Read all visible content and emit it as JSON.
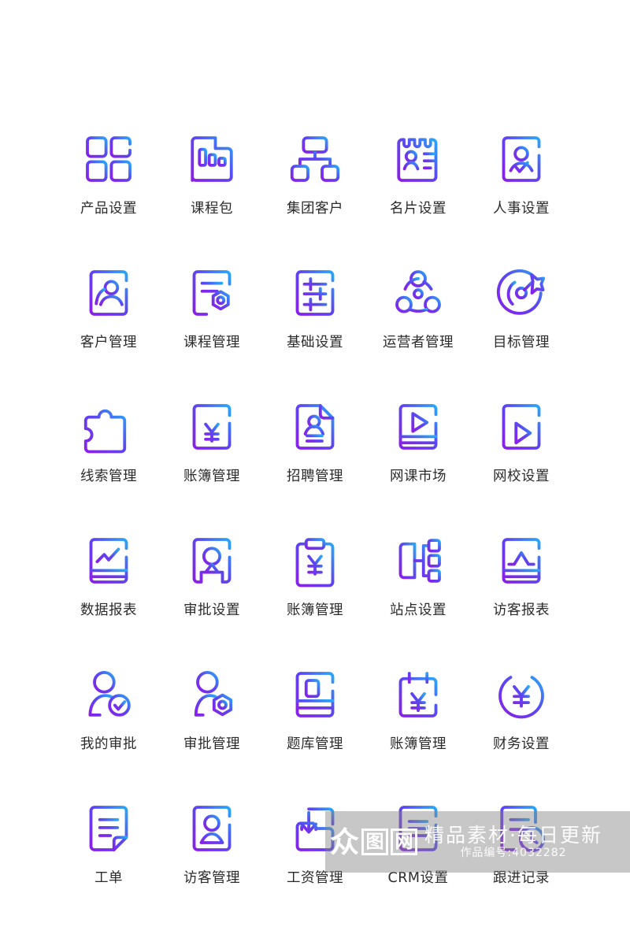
{
  "page": {
    "background": "#ffffff",
    "label_color": "#2b2b2b",
    "gradient_start": "#8A1FE8",
    "gradient_end": "#29A8F7",
    "columns": 5,
    "rows": 6,
    "total_icons": 30
  },
  "icons": [
    {
      "label": "产品设置",
      "name": "product-settings"
    },
    {
      "label": "课程包",
      "name": "course-package"
    },
    {
      "label": "集团客户",
      "name": "group-customer"
    },
    {
      "label": "名片设置",
      "name": "business-card-settings"
    },
    {
      "label": "人事设置",
      "name": "hr-settings"
    },
    {
      "label": "客户管理",
      "name": "customer-management"
    },
    {
      "label": "课程管理",
      "name": "course-management"
    },
    {
      "label": "基础设置",
      "name": "basic-settings"
    },
    {
      "label": "运营者管理",
      "name": "operator-management"
    },
    {
      "label": "目标管理",
      "name": "goal-management"
    },
    {
      "label": "线索管理",
      "name": "lead-management"
    },
    {
      "label": "账簿管理",
      "name": "ledger-management-1"
    },
    {
      "label": "招聘管理",
      "name": "recruitment-management"
    },
    {
      "label": "网课市场",
      "name": "online-course-market"
    },
    {
      "label": "网校设置",
      "name": "online-school-settings"
    },
    {
      "label": "数据报表",
      "name": "data-report"
    },
    {
      "label": "审批设置",
      "name": "approval-settings"
    },
    {
      "label": "账簿管理",
      "name": "ledger-management-2"
    },
    {
      "label": "站点设置",
      "name": "site-settings"
    },
    {
      "label": "访客报表",
      "name": "visitor-report"
    },
    {
      "label": "我的审批",
      "name": "my-approval"
    },
    {
      "label": "审批管理",
      "name": "approval-management"
    },
    {
      "label": "题库管理",
      "name": "question-bank-management"
    },
    {
      "label": "账簿管理",
      "name": "ledger-management-3"
    },
    {
      "label": "财务设置",
      "name": "finance-settings"
    },
    {
      "label": "工单",
      "name": "work-order"
    },
    {
      "label": "访客管理",
      "name": "visitor-management"
    },
    {
      "label": "工资管理",
      "name": "payroll-management"
    },
    {
      "label": "CRM设置",
      "name": "crm-settings"
    },
    {
      "label": "跟进记录",
      "name": "follow-up-record"
    }
  ],
  "watermark": {
    "brand_char_1": "众",
    "brand_char_2": "图",
    "brand_char_3": "网",
    "tagline": "精品素材·每日更新",
    "work_id": "作品编号:4032282"
  }
}
